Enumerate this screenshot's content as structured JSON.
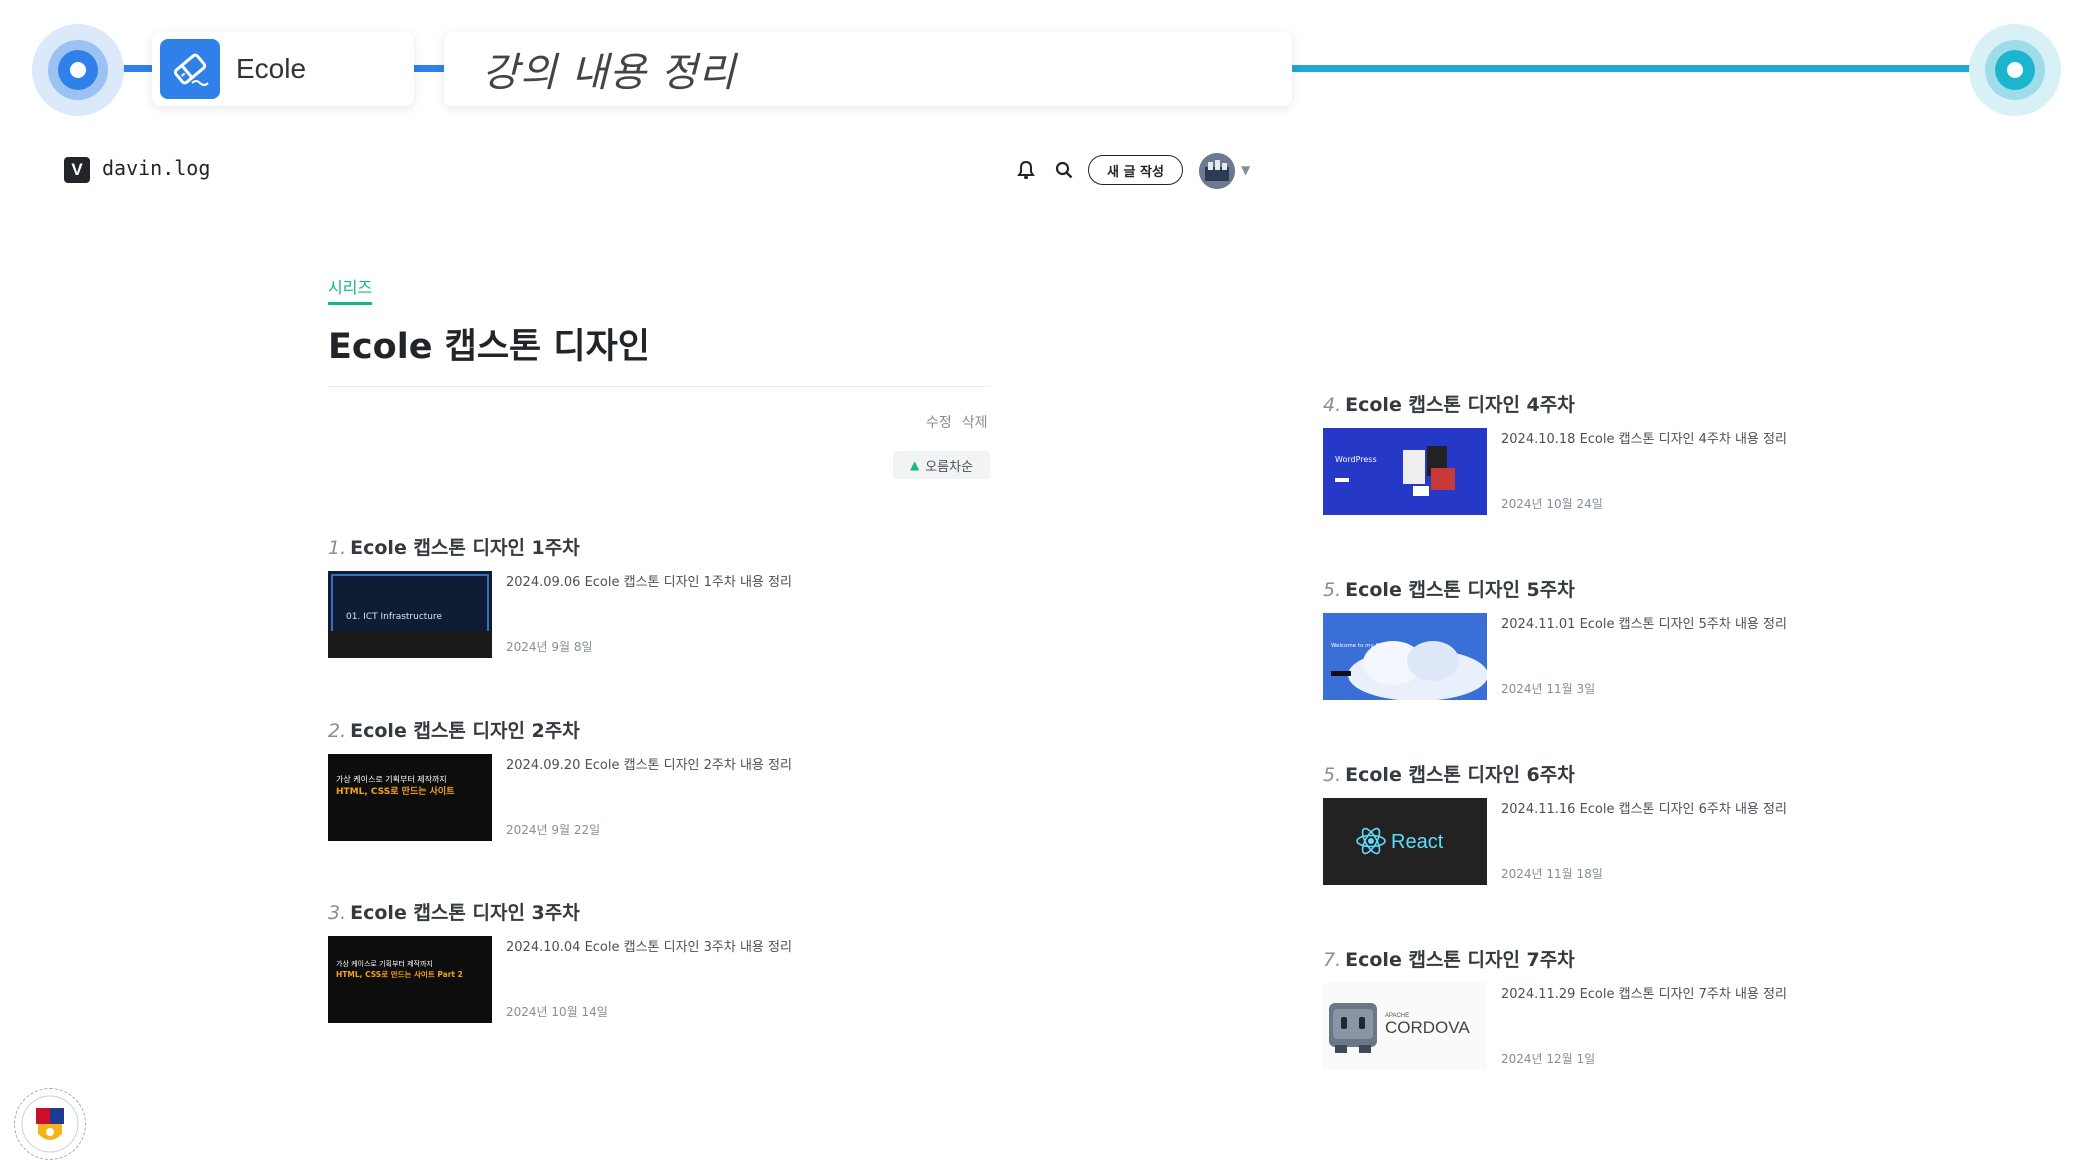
{
  "slide": {
    "category_label": "Ecole",
    "title": "강의 내용 정리",
    "colors": {
      "left_accent": "#2f80e8",
      "right_accent": "#1cb4cf"
    }
  },
  "velog": {
    "brand": "davin.log",
    "logo_letter": "V",
    "write_button": "새 글 작성",
    "icons": [
      "bell-icon",
      "search-icon",
      "avatar",
      "caret-down-icon"
    ],
    "series_tag": "시리즈",
    "series_title": "Ecole 캡스톤 디자인",
    "edit_label": "수정",
    "delete_label": "삭제",
    "sort_label": "오름차순",
    "accent_color": "#12b886"
  },
  "posts": [
    {
      "num": "1.",
      "title": "Ecole 캡스톤 디자인 1주차",
      "desc": "2024.09.06 Ecole 캡스톤 디자인 1주차 내용 정리",
      "date": "2024년 9월 8일",
      "thumb_text": "01. ICT Infrastructure",
      "thumb_sub": ""
    },
    {
      "num": "2.",
      "title": "Ecole 캡스톤 디자인 2주차",
      "desc": "2024.09.20 Ecole 캡스톤 디자인 2주차 내용 정리",
      "date": "2024년 9월 22일",
      "thumb_text": "가상 케이스로 기획부터 제작까지",
      "thumb_sub": "HTML, CSS로 만드는 사이트"
    },
    {
      "num": "3.",
      "title": "Ecole 캡스톤 디자인 3주차",
      "desc": "2024.10.04 Ecole 캡스톤 디자인 3주차 내용 정리",
      "date": "2024년 10월 14일",
      "thumb_text": "가상 케이스로 기획부터 제작까지",
      "thumb_sub": "HTML, CSS로 만드는 사이트 Part 2"
    },
    {
      "num": "4.",
      "title": "Ecole 캡스톤 디자인 4주차",
      "desc": "2024.10.18 Ecole 캡스톤 디자인 4주차 내용 정리",
      "date": "2024년 10월 24일",
      "thumb_text": "WordPress",
      "thumb_sub": ""
    },
    {
      "num": "5.",
      "title": "Ecole 캡스톤 디자인 5주차",
      "desc": "2024.11.01 Ecole 캡스톤 디자인 5주차 내용 정리",
      "date": "2024년 11월 3일",
      "thumb_text": "Welcome to my Portfolio",
      "thumb_sub": ""
    },
    {
      "num": "5.",
      "title": "Ecole 캡스톤 디자인 6주차",
      "desc": "2024.11.16 Ecole 캡스톤 디자인 6주차 내용 정리",
      "date": "2024년 11월 18일",
      "thumb_text": "React",
      "thumb_sub": ""
    },
    {
      "num": "7.",
      "title": "Ecole 캡스톤 디자인 7주차",
      "desc": "2024.11.29 Ecole 캡스톤 디자인 7주차 내용 정리",
      "date": "2024년 12월 1일",
      "thumb_text": "CORDOVA",
      "thumb_sub": "APACHE"
    }
  ]
}
